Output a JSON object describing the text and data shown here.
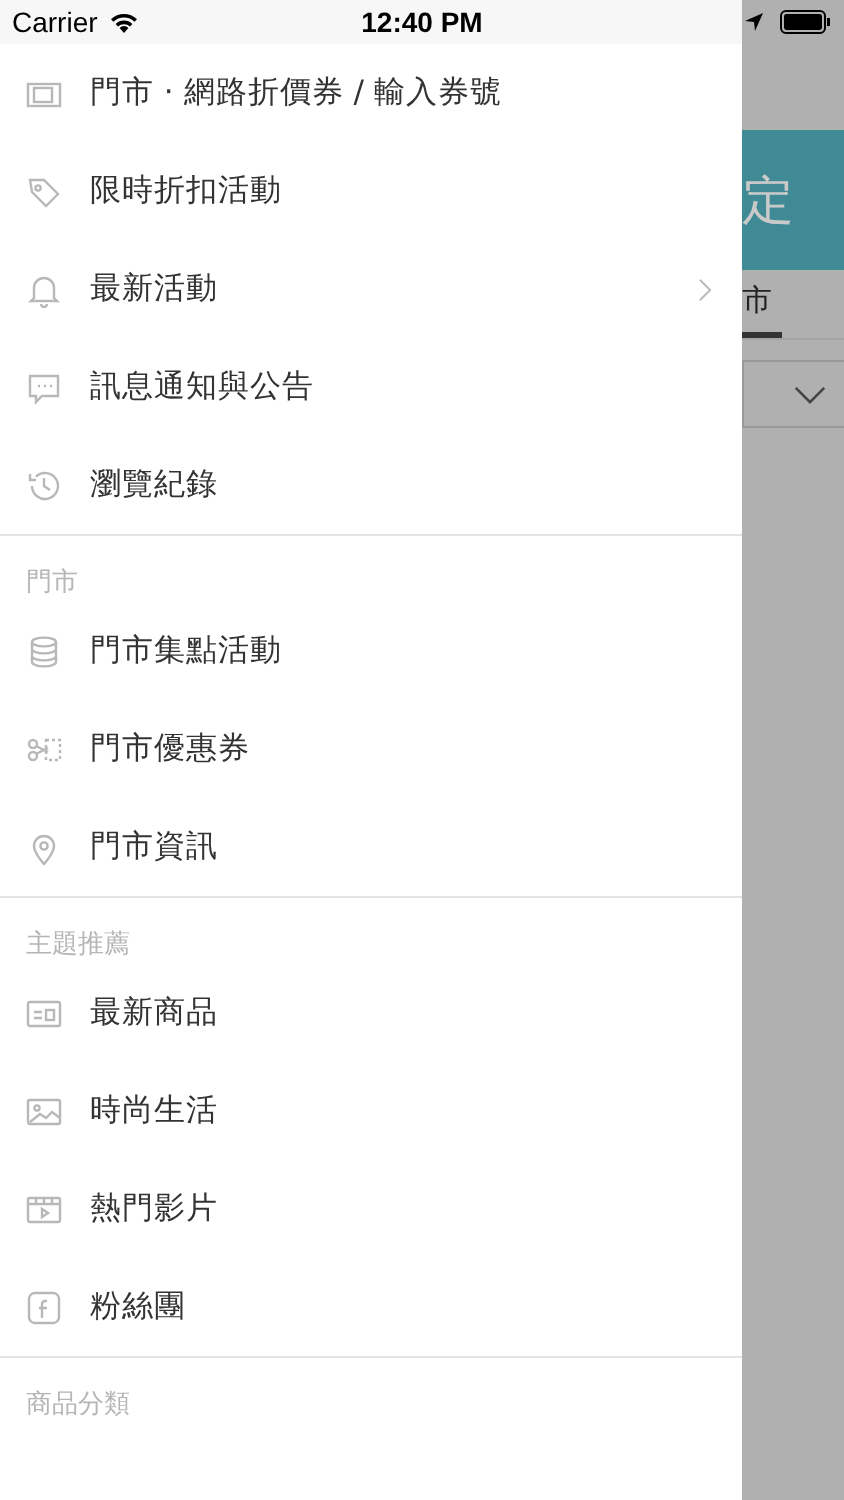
{
  "status_bar": {
    "carrier": "Carrier",
    "time": "12:40 PM"
  },
  "drawer": {
    "sections": [
      {
        "items": [
          {
            "label": "門市 · 網路折價券 / 輸入券號",
            "submenu": false
          },
          {
            "label": "限時折扣活動",
            "submenu": false
          },
          {
            "label": "最新活動",
            "submenu": true
          },
          {
            "label": "訊息通知與公告",
            "submenu": false
          },
          {
            "label": "瀏覽紀錄",
            "submenu": false
          }
        ]
      },
      {
        "header": "門市",
        "items": [
          {
            "label": "門市集點活動",
            "submenu": false
          },
          {
            "label": "門市優惠券",
            "submenu": false
          },
          {
            "label": "門市資訊",
            "submenu": false
          }
        ]
      },
      {
        "header": "主題推薦",
        "items": [
          {
            "label": "最新商品",
            "submenu": false
          },
          {
            "label": "時尚生活",
            "submenu": false
          },
          {
            "label": "熱門影片",
            "submenu": false
          },
          {
            "label": "粉絲團",
            "submenu": false
          }
        ]
      },
      {
        "header": "商品分類"
      }
    ]
  },
  "background_screen": {
    "button_label": "定",
    "tab": {
      "label": "市",
      "selected": true
    }
  }
}
